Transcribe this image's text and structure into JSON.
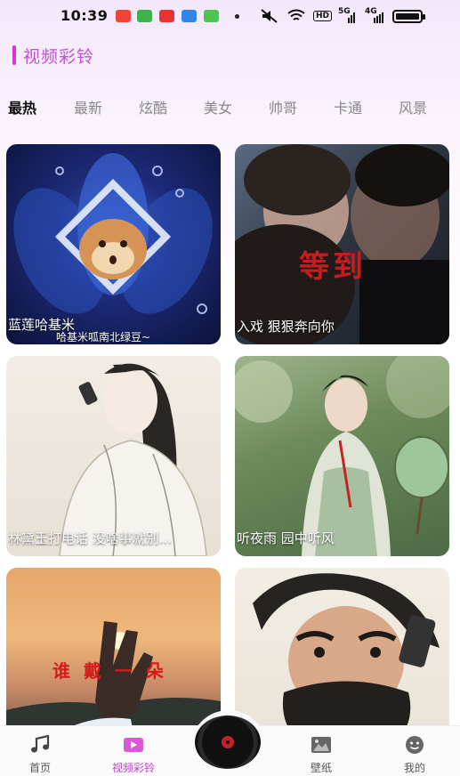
{
  "status_bar": {
    "time": "10:39",
    "hd": "HD",
    "net1": "5G",
    "net2": "4G"
  },
  "page": {
    "title": "视频彩铃"
  },
  "categories": [
    {
      "label": "最热",
      "active": true
    },
    {
      "label": "最新",
      "active": false
    },
    {
      "label": "炫酷",
      "active": false
    },
    {
      "label": "美女",
      "active": false
    },
    {
      "label": "帅哥",
      "active": false
    },
    {
      "label": "卡通",
      "active": false
    },
    {
      "label": "风景",
      "active": false
    }
  ],
  "cards": [
    {
      "caption": "蓝莲哈基米",
      "subtitle": "哈基米呱南北绿豆~"
    },
    {
      "caption": "入戏 狠狠奔向你",
      "overlay": "等到"
    },
    {
      "caption": "林黛玉打电话 没啥事就别..."
    },
    {
      "caption": "听夜雨 园中听风"
    },
    {
      "caption": "",
      "overlay": "谁 戴 一 朵"
    },
    {
      "caption": ""
    }
  ],
  "bottom_nav": {
    "items": [
      {
        "label": "首页",
        "icon": "music-note-icon",
        "active": false
      },
      {
        "label": "视频彩铃",
        "icon": "video-play-icon",
        "active": true
      },
      {
        "label": "壁纸",
        "icon": "image-icon",
        "active": false
      },
      {
        "label": "我的",
        "icon": "smiley-face-icon",
        "active": false
      }
    ],
    "center_icon": "vinyl-record-icon"
  },
  "colors": {
    "accent": "#c43bd8",
    "title_bar_accent": "#e52fd6"
  }
}
